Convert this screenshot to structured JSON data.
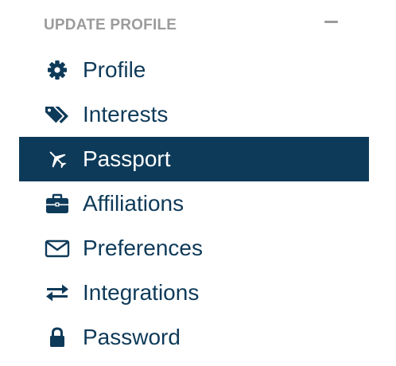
{
  "header": {
    "title": "UPDATE PROFILE",
    "collapse_icon": "minus-icon"
  },
  "colors": {
    "primary": "#0e3a59",
    "active_bg": "#0d3a59",
    "active_text": "#ffffff",
    "header_text": "#9b9b9b"
  },
  "menu": {
    "active_item": "Passport",
    "items": [
      {
        "label": "Profile",
        "icon": "gear-icon"
      },
      {
        "label": "Interests",
        "icon": "tags-icon"
      },
      {
        "label": "Passport",
        "icon": "plane-icon"
      },
      {
        "label": "Affiliations",
        "icon": "briefcase-icon"
      },
      {
        "label": "Preferences",
        "icon": "envelope-icon"
      },
      {
        "label": "Integrations",
        "icon": "exchange-icon"
      },
      {
        "label": "Password",
        "icon": "lock-icon"
      }
    ]
  }
}
